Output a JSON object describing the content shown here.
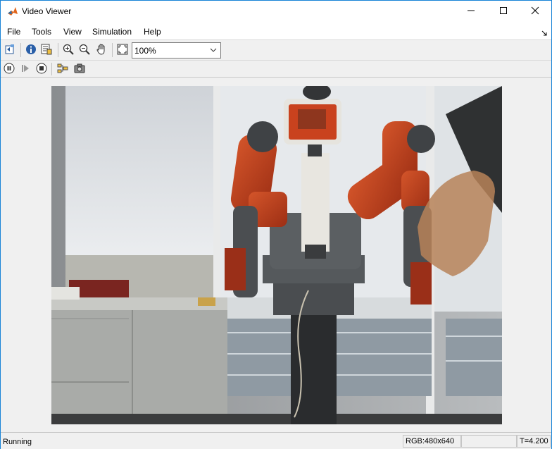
{
  "window": {
    "title": "Video Viewer",
    "icon": "matlab-logo-icon"
  },
  "window_controls": {
    "minimize": "minimize-icon",
    "maximize": "maximize-icon",
    "close": "close-icon"
  },
  "menu": {
    "items": [
      "File",
      "Tools",
      "View",
      "Simulation",
      "Help"
    ]
  },
  "toolbar": {
    "icons": [
      "print-to-figure-icon",
      "info-icon",
      "export-icon",
      "zoom-in-icon",
      "zoom-out-icon",
      "pan-hand-icon",
      "fit-to-window-icon"
    ],
    "zoom_value": "100%"
  },
  "playback_toolbar": {
    "icons": [
      "pause-icon",
      "step-forward-icon",
      "stop-icon",
      "highlight-block-icon",
      "snapshot-camera-icon"
    ]
  },
  "video": {
    "content": "robot-camera-frame"
  },
  "status": {
    "state": "Running",
    "resolution": "RGB:480x640",
    "empty": "",
    "time": "T=4.200"
  },
  "colors": {
    "window_border": "#1883d7",
    "toolbar_bg": "#f0f0f0",
    "robot_red": "#c0441f"
  }
}
